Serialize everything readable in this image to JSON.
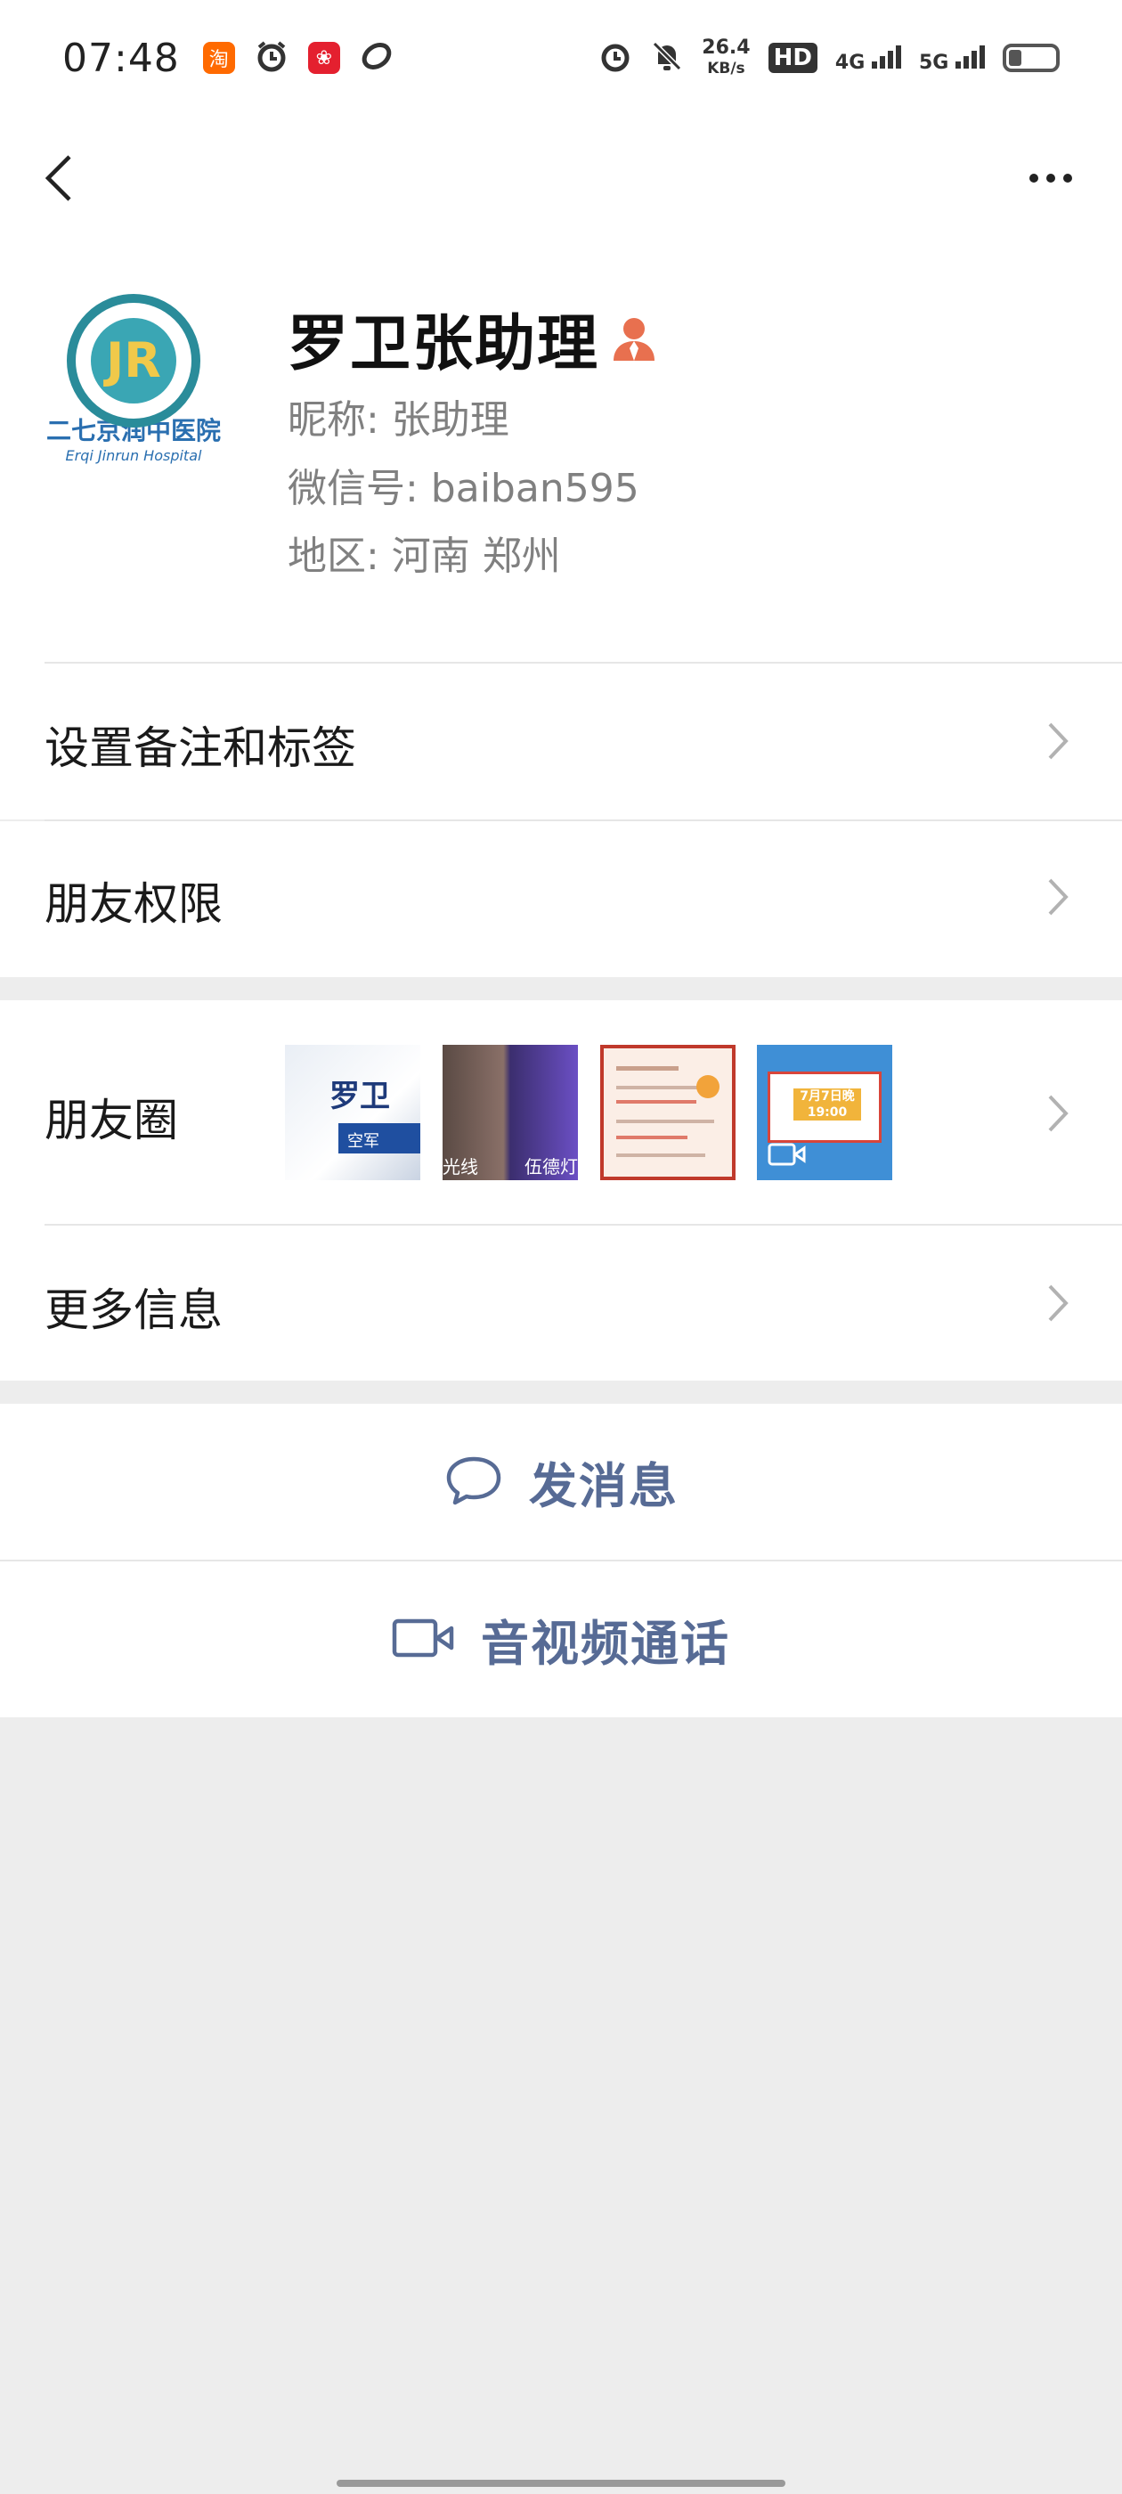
{
  "status_bar": {
    "time": "07:48",
    "net_speed_value": "26.4",
    "net_speed_unit": "KB/s",
    "hd": "HD",
    "net_4g": "4G",
    "net_5g": "5G",
    "app_icons": [
      "taobao-icon",
      "alarm-icon",
      "app-red-icon",
      "link-icon"
    ],
    "colors": {
      "taobao": "#ff6a00",
      "red_app": "#e4202f"
    }
  },
  "profile": {
    "name": "罗卫张助理",
    "nickname_line": "昵称: 张助理",
    "wechat_id_line": "微信号: baiban595",
    "region_line": "地区: 河南  郑州",
    "avatar": {
      "name_text": "二七京润中医院",
      "sub_text": "Erqi Jinrun Hospital",
      "mark": "JR"
    }
  },
  "cells": {
    "remark": "设置备注和标签",
    "permissions": "朋友权限",
    "moments": "朋友圈",
    "more_info": "更多信息"
  },
  "moments_thumbs": {
    "t1_text": "罗卫",
    "t1_sub": "空军",
    "t2_left": "光线",
    "t2_right": "伍德灯",
    "t4_text": "7月7日晚",
    "t4_time": "19:00"
  },
  "actions": {
    "message": "发消息",
    "video_call": "音视频通话"
  },
  "colors": {
    "link_blue": "#576b95",
    "background": "#ededed",
    "person_icon": "#e8704f"
  }
}
